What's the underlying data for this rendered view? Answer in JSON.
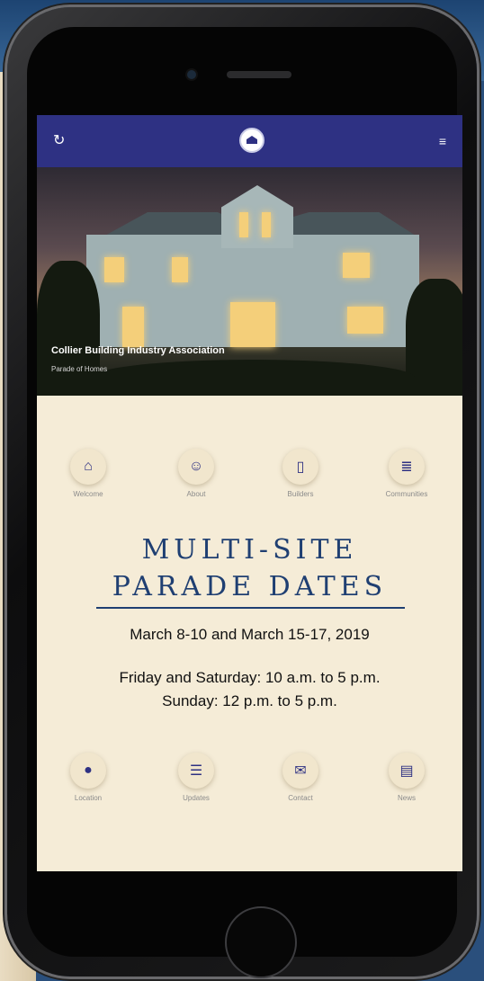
{
  "header": {
    "refresh_icon": "refresh-icon",
    "menu_icon": "menu-icon"
  },
  "hero": {
    "title": "Collier Building Industry Association",
    "subtitle": "Parade of Homes"
  },
  "top_nav": [
    {
      "label": "Welcome",
      "icon": "home-icon"
    },
    {
      "label": "About",
      "icon": "users-icon"
    },
    {
      "label": "Builders",
      "icon": "building-icon"
    },
    {
      "label": "Communities",
      "icon": "signpost-icon"
    }
  ],
  "content": {
    "headline_line1": "MULTI-SITE",
    "headline_line2": "PARADE DATES",
    "dates": "March 8-10 and March 15-17, 2019",
    "hours_line1": "Friday and Saturday: 10 a.m. to 5 p.m.",
    "hours_line2": "Sunday: 12 p.m. to 5 p.m."
  },
  "bottom_nav": [
    {
      "label": "Location",
      "icon": "map-pin-icon"
    },
    {
      "label": "Updates",
      "icon": "list-icon"
    },
    {
      "label": "Contact",
      "icon": "envelope-icon"
    },
    {
      "label": "News",
      "icon": "newspaper-icon"
    }
  ],
  "colors": {
    "header_bg": "#2e3183",
    "screen_bg": "#f5ecd7",
    "headline": "#1f3f72"
  }
}
